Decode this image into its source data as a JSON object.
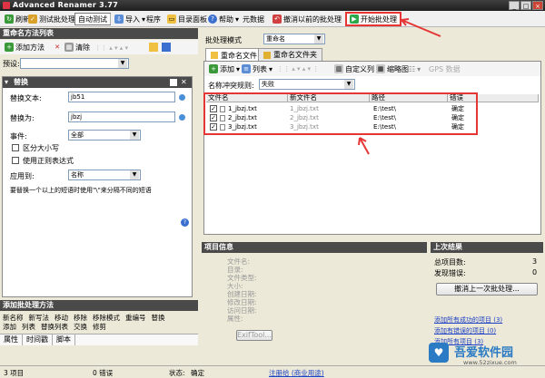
{
  "window": {
    "title": "Advanced Renamer 3.77"
  },
  "toolbar": {
    "refresh": "刷新",
    "test_batch": "测试批处理",
    "auto_test": "自动测试",
    "import": "导入",
    "program": "程序",
    "dir_panel": "目录面板",
    "help": "帮助",
    "metadata": "元数据",
    "undo_last": "撤消以前的批处理",
    "start_batch": "开始批处理"
  },
  "left": {
    "header": "重命名方法列表",
    "add_method": "添加方法",
    "clear": "清除",
    "preset_label": "预设:",
    "panel": {
      "title": "替换",
      "replace_text_label": "替换文本:",
      "replace_text_value": "jb51",
      "replace_with_label": "替换为:",
      "replace_with_value": "jbzj",
      "occurrence_label": "事件:",
      "occurrence_value": "全部",
      "case_sensitive": "区分大小写",
      "use_regex": "使用正则表达式",
      "apply_to_label": "应用到:",
      "apply_to_value": "名称",
      "hint": "要替换一个以上的短语时使用\"\\\"来分隔不同的短语",
      "help_icon": "?"
    },
    "add_batch_header": "添加批处理方法",
    "methods_row1": [
      "新名称",
      "新写法",
      "移动",
      "移除",
      "移除模式",
      "重编号",
      "替换"
    ],
    "methods_row2": [
      "添加",
      "列表",
      "替换列表",
      "交换",
      "修剪"
    ],
    "tabs": [
      "属性",
      "时间戳",
      "脚本"
    ]
  },
  "right": {
    "batch_mode_label": "批处理模式",
    "batch_mode_value": "重命名",
    "tabs": [
      "重命名文件",
      "重命名文件夹"
    ],
    "file_tools": {
      "add": "添加",
      "list": "列表",
      "custom_columns": "自定义列",
      "thumbnails": "缩略图",
      "gps": "GPS 数据"
    },
    "conflict_label": "名称冲突规则:",
    "conflict_value": "失败",
    "columns": [
      "文件名",
      "新文件名",
      "路径",
      "错误"
    ],
    "rows": [
      {
        "checked": true,
        "name": "1_jbzj.txt",
        "new_name": "1_jbzj.txt",
        "path": "E:\\test\\",
        "error": "确定"
      },
      {
        "checked": true,
        "name": "2_jbzj.txt",
        "new_name": "2_jbzj.txt",
        "path": "E:\\test\\",
        "error": "确定"
      },
      {
        "checked": true,
        "name": "3_jbzj.txt",
        "new_name": "3_jbzj.txt",
        "path": "E:\\test\\",
        "error": "确定"
      }
    ]
  },
  "info": {
    "header": "项目信息",
    "labels": [
      "文件名:",
      "目录:",
      "文件类型:",
      "大小:",
      "创建日期:",
      "修改日期:",
      "访问日期:",
      "属性:"
    ],
    "exiftool": "ExifTool..."
  },
  "lastresult": {
    "header": "上次结果",
    "total_label": "总项目数:",
    "total_value": "3",
    "errors_label": "发现错误:",
    "errors_value": "0",
    "undo_button": "撤消上一次批处理...",
    "link1": "添加所有成功的项目 (3)",
    "link2": "添加有错误的项目 (0)",
    "link3": "添加所有项目 (3)"
  },
  "status": {
    "items": "3 项目",
    "errors": "0 错误",
    "state_label": "状态:",
    "state_value": "确定",
    "register": "注册给 (商业用途)"
  },
  "watermark": {
    "text": "吾爱软件园",
    "url": "www.52zixue.com"
  },
  "colors": {
    "highlight": "#e53535",
    "header_bg": "#4a4a4a",
    "link": "#1c3fc4"
  }
}
